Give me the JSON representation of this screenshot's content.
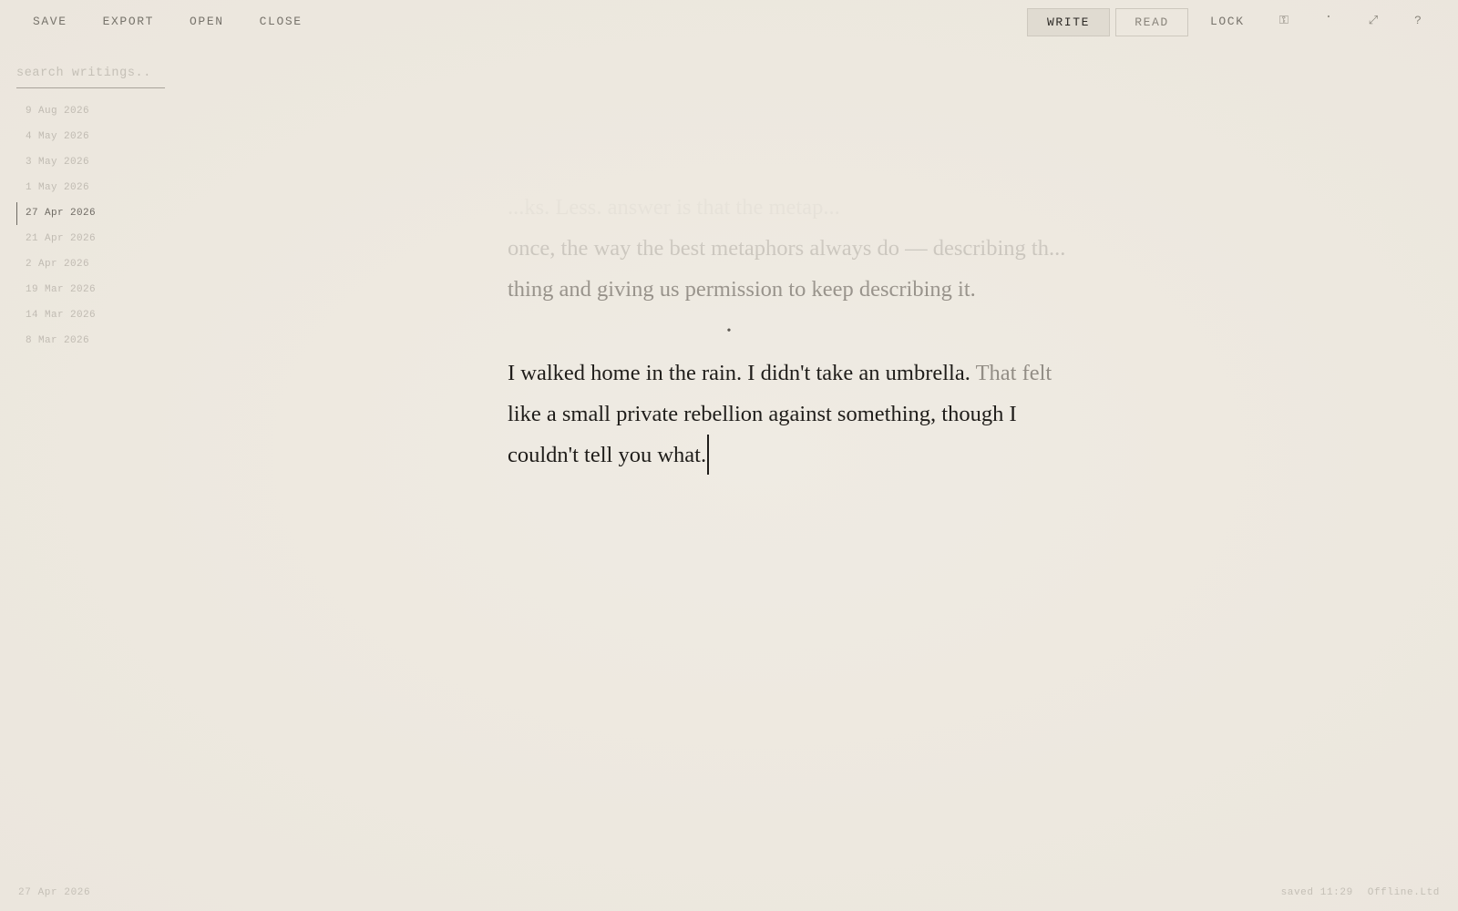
{
  "toolbar": {
    "save": "SAVE",
    "export": "EXPORT",
    "open": "OPEN",
    "close": "CLOSE",
    "write": "WRITE",
    "read": "READ",
    "lock": "LOCK",
    "active_mode": "write",
    "icons": [
      "key-icon",
      "dot-icon",
      "expand-icon",
      "help-icon"
    ],
    "icon_glyphs": {
      "key": "⚿",
      "dot": "·",
      "expand": "⤢",
      "help": "?"
    }
  },
  "sidebar": {
    "search_placeholder": "search writings..",
    "dates": [
      "9 Aug 2026",
      "4 May 2026",
      "3 May 2026",
      "1 May 2026",
      "27 Apr 2026",
      "21 Apr 2026",
      "2 Apr 2026",
      "19 Mar 2026",
      "14 Mar 2026",
      "8 Mar 2026"
    ],
    "active_index": 4
  },
  "editor": {
    "previous_paragraph_lines": [
      "...ks. Less. answer is that the metap...",
      "once, the way the best metaphors always do — describing th...",
      "thing and giving us permission to keep describing it."
    ],
    "separator": "•",
    "current_paragraph": {
      "line1_main": "I walked home in the rain. I didn't take an umbrella.",
      "line1_dim": "That felt",
      "line2": "like a small private rebellion against something, though I",
      "line3": "couldn't tell you what."
    }
  },
  "footer": {
    "date": "27 Apr 2026",
    "saved": "saved 11:29",
    "brand": "Offline.Ltd"
  },
  "colors": {
    "background": "#ede8df",
    "text": "#1f1d1a",
    "muted": "#77736b",
    "active_button_bg": "#e0dbd1"
  }
}
